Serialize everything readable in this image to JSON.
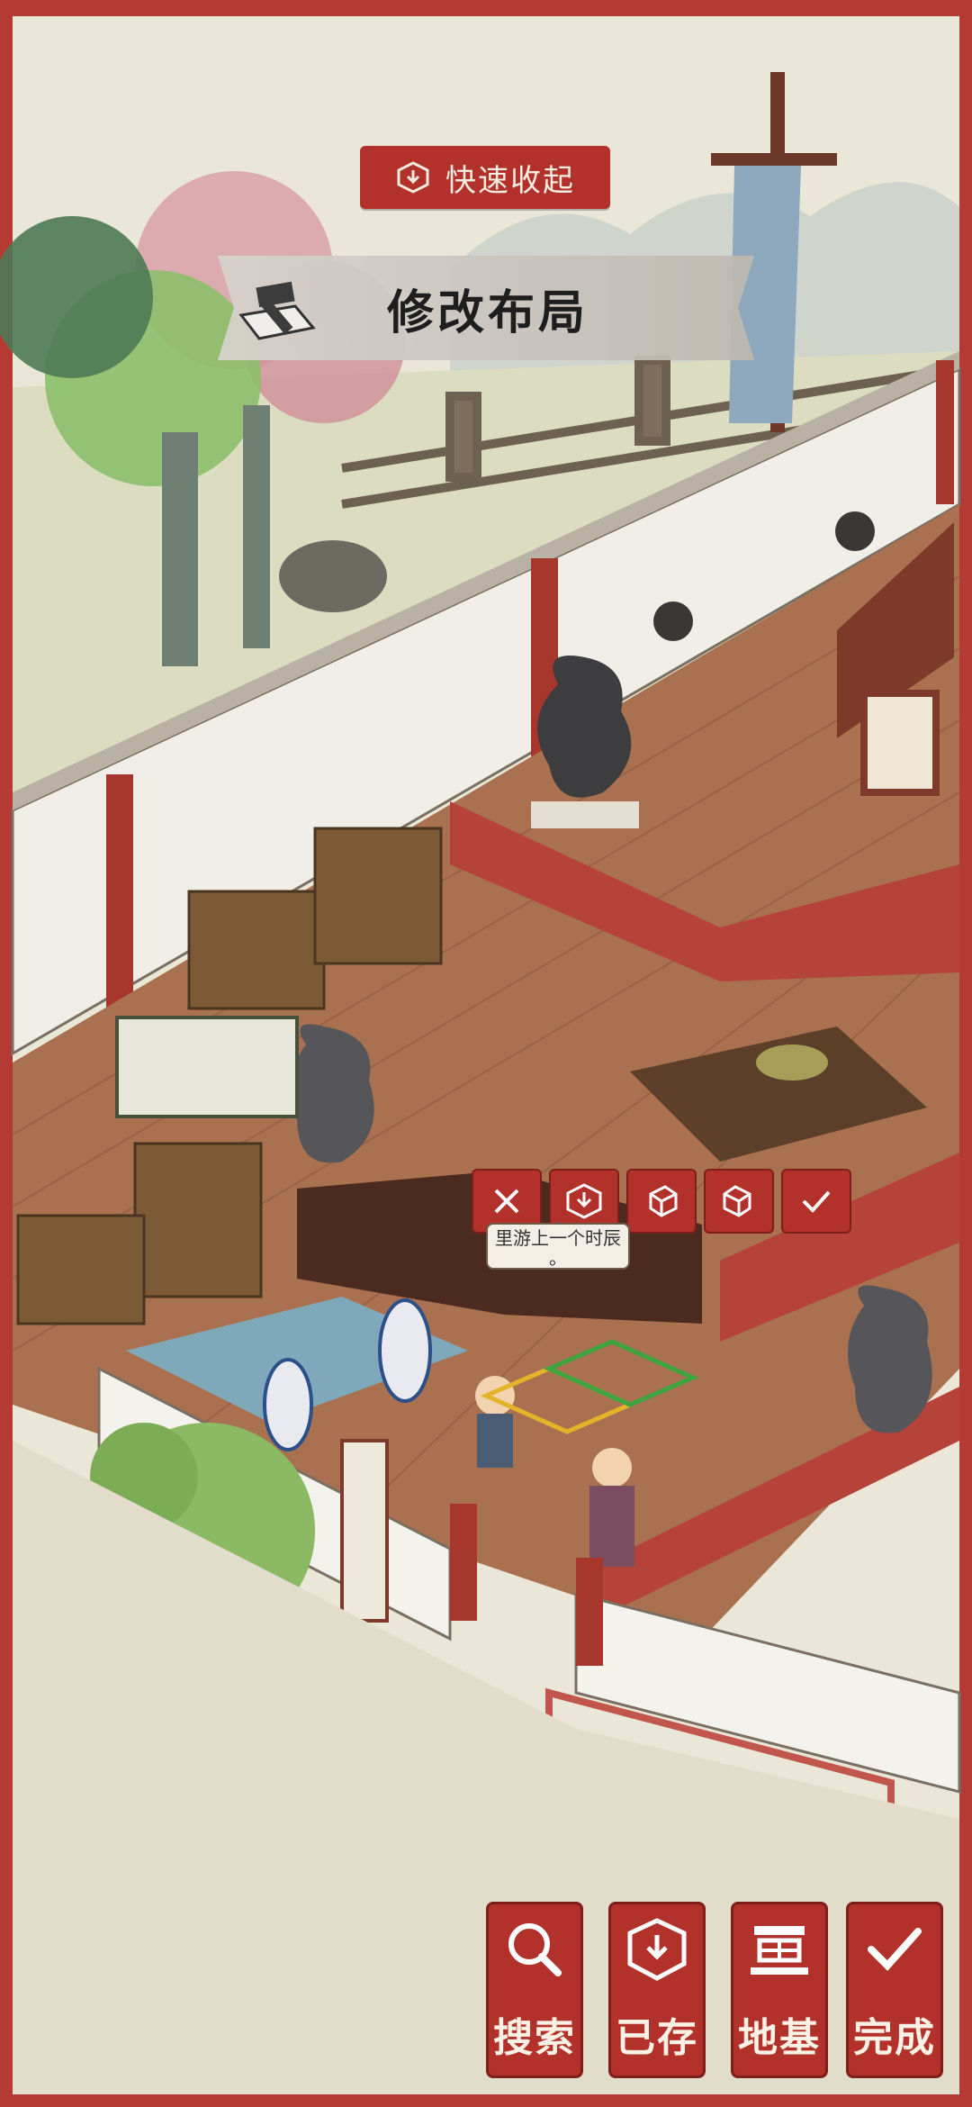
{
  "header": {
    "quick_collapse_label": "快速收起",
    "mode_title": "修改布局"
  },
  "edit_toolbar": {
    "icons": [
      "close-icon",
      "store-icon",
      "rotate-left-icon",
      "rotate-right-icon",
      "confirm-icon"
    ]
  },
  "speech_bubble": {
    "text": "里游上一个时辰",
    "tail": "。"
  },
  "bottom_bar": {
    "search_label": "搜索",
    "stored_label": "已存",
    "foundation_label": "地基",
    "done_label": "完成"
  },
  "colors": {
    "frame": "#b53a34",
    "button": "#b3312b",
    "floor": "#a9714f",
    "wall": "#efece6"
  }
}
